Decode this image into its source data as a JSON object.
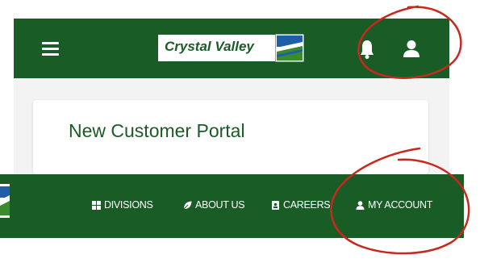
{
  "mobile_header": {
    "logo_text": "Crystal Valley",
    "icons": [
      "hamburger-menu-icon",
      "bell-icon",
      "user-icon"
    ]
  },
  "card": {
    "title": "New Customer Portal"
  },
  "desktop_nav": {
    "items": [
      {
        "label": "DIVISIONS",
        "icon": "grid-icon"
      },
      {
        "label": "ABOUT US",
        "icon": "leaf-icon"
      },
      {
        "label": "CAREERS",
        "icon": "id-badge-icon"
      },
      {
        "label": "MY ACCOUNT",
        "icon": "user-icon"
      }
    ]
  },
  "colors": {
    "brand_green": "#1a5c25",
    "logo_blue": "#1e5fa8",
    "annotation_red": "#c8281e",
    "page_bg": "#f3f3f3"
  }
}
